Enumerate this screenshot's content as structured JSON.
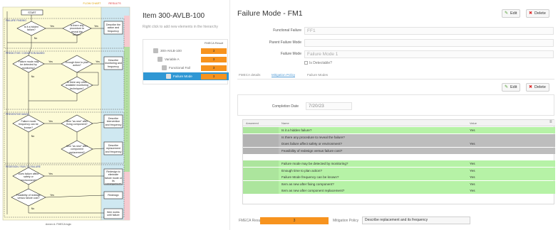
{
  "flowchart": {
    "header_left": "FLOW CHART",
    "header_right": "RESULTS",
    "start": "START",
    "sections": [
      "FAILURE FINDING",
      "PREDICTIVE / CONDITION BASED",
      "PREVENTIVE MAINT.",
      "REDESIGN / RUN-TO-FAILURE"
    ],
    "nodes": [
      "Is it a hidden failure?",
      "Is there any procedure to reveal the failure?",
      "Failure mode may be detected by monitoring?",
      "Enough time to plan action?",
      "Is there any other available monitoring techniques?",
      "Failure mode frequency can be known?",
      "Item \"as new\" after fixing component?",
      "Item \"as new\" after component replacement?",
      "Does failure affect safety or environment?",
      "Feasibility of redesign versus failure cost?"
    ],
    "results": [
      "Describe the action and frequency",
      "Describe monitoring and frequency",
      "Describe intervention and frequency",
      "Describe replacement and frequency",
      "Redesign to eliminate failure mode or its consequences",
      "Redesign",
      "Item works until failure"
    ],
    "labels": {
      "yes": "Yes",
      "no": "No"
    },
    "caption": "Annex A: FMECA logic",
    "colors": {
      "panel": "#fdfbd7",
      "right_band": "#cfe8f1",
      "green_band": "#b4dea1",
      "pink_band": "#f6cad0",
      "line": "#222222"
    }
  },
  "tree": {
    "title": "Item 300-AVLB-100",
    "hint": "Right click to add new elements in the hierarchy",
    "column": "FMECA Result",
    "rows": [
      {
        "label": "300-AVLB-100",
        "value": "3",
        "selected": false
      },
      {
        "label": "Variable A",
        "value": "3",
        "selected": false
      },
      {
        "label": "Functional Fail",
        "value": "3",
        "selected": false
      },
      {
        "label": "Failure Mode",
        "value": "3",
        "selected": true
      }
    ]
  },
  "detail": {
    "title": "Failure Mode - FM1",
    "edit_label": "Edit",
    "delete_label": "Delete",
    "fields": [
      {
        "label": "Functional Failure",
        "value": "FF1"
      },
      {
        "label": "Parent Failure Mode",
        "value": ""
      },
      {
        "label": "Failure Mode",
        "value": "Failure Mode 1"
      }
    ],
    "is_detectable": "Is Detectable?",
    "tabs": [
      "FMECA details",
      "Mitigation Policy",
      "Failure Modes"
    ],
    "active_tab": 1,
    "completion_label": "Completion Date",
    "completion_value": "7/20/23",
    "grid_headers": {
      "answer": "Answered",
      "name": "Name",
      "value": "Value"
    },
    "questions": [
      {
        "name": "Is it a hidden failure?",
        "value": "Yes",
        "style": "green"
      },
      {
        "name": "Is there any procedure to reveal the failure?",
        "value": "",
        "style": "gray"
      },
      {
        "name": "Does failure affect safety or environment?",
        "value": "Yes",
        "style": "gray"
      },
      {
        "name": "Feasibility of redesign versus failure cost?",
        "value": "",
        "style": "gray"
      },
      {
        "name": "Failure mode may be detected by monitoring?",
        "value": "Yes",
        "style": "green"
      },
      {
        "name": "Enough time to plan action?",
        "value": "Yes",
        "style": "green"
      },
      {
        "name": "Failure Mode frequency can be known?",
        "value": "Yes",
        "style": "green"
      },
      {
        "name": "Item as new after fixing component?",
        "value": "Yes",
        "style": "green"
      },
      {
        "name": "Item as new after component replacement?",
        "value": "Yes",
        "style": "green"
      }
    ],
    "fmeca_result_label": "FMECA Result",
    "fmeca_result_value": "3",
    "mitigation_label": "Mitigation Policy",
    "mitigation_value": "Describe replacement and its frequency",
    "colors": {
      "orange": "#f7931e",
      "green_row": "#b6f2a6",
      "gray_row": "#bdbdbd",
      "selected_row": "#2f97d4",
      "link": "#5aa0d8"
    }
  }
}
